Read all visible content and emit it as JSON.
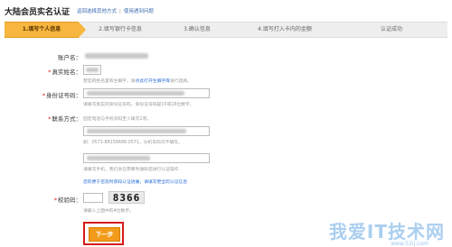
{
  "header": {
    "title": "大陆会员实名认证",
    "link_other": "返回选择其他方式",
    "link_help": "使用遇到问题"
  },
  "steps": [
    {
      "label": "1.填写个人信息",
      "active": true
    },
    {
      "label": "2.填写银行卡信息",
      "active": false
    },
    {
      "label": "3.确认信息",
      "active": false
    },
    {
      "label": "4.填写打入卡内的金额",
      "active": false
    },
    {
      "label": "认证成功",
      "active": false
    }
  ],
  "form": {
    "account_label": "账户名：",
    "realname_label": "真实姓名：",
    "realname_hint": "若您的姓名里有生僻字，请",
    "realname_hint_link": "点此打开生僻字库",
    "realname_hint_tail": "进行选择。",
    "id_label": "身份证号码：",
    "id_hint": "请填写真实的身份证号码，身份证号码是15或18位数字。",
    "contact_label": "联系方式：",
    "contact_hint": "固定电话与手机号码至少填写1项。",
    "phone_hint": "如：0571-88156688-0571，分机号码可不填写。",
    "mobile_hint": "请填写手机，我们会在需要时通知您进行认证操作",
    "mobile_link": "您的便于您及时获知认证进展，请填写更全的认证信息",
    "captcha_label": "校验码：",
    "captcha_text": "8366",
    "captcha_hint": "请输入上图中的4位数字。",
    "next_label": "下一步"
  },
  "watermark": {
    "main": "我爱IT技术网",
    "sub": "www.52ij.com"
  }
}
